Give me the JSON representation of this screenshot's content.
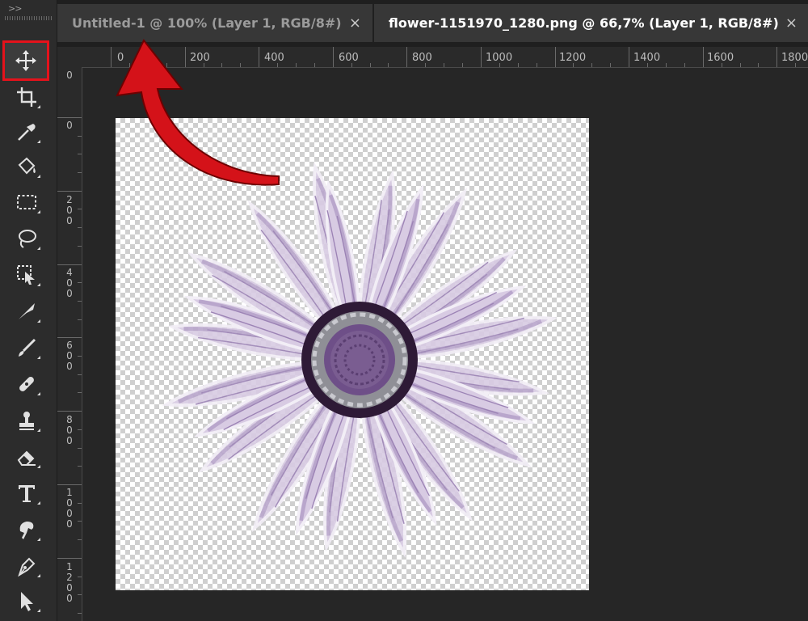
{
  "toolbar": {
    "collapse_glyph": ">>",
    "tools": [
      "move-tool",
      "crop-tool",
      "eyedropper-tool",
      "paint-bucket-tool",
      "rectangular-marquee-tool",
      "lasso-tool",
      "object-selection-tool",
      "pen-curvature-tool",
      "brush-tool",
      "healing-brush-tool",
      "clone-stamp-tool",
      "eraser-tool",
      "type-tool",
      "smudge-tool",
      "pen-tool",
      "path-selection-tool"
    ],
    "selected_tool": "move-tool"
  },
  "tabs": [
    {
      "title": "Untitled-1 @ 100% (Layer 1, RGB/8#)",
      "close": "×",
      "active": false
    },
    {
      "title": "flower-1151970_1280.png @ 66,7% (Layer 1, RGB/8#)",
      "close": "×",
      "active": true
    }
  ],
  "ruler": {
    "horizontal_labels": [
      "0",
      "200",
      "400",
      "600",
      "800",
      "1000",
      "1200",
      "1400",
      "1600",
      "1800"
    ],
    "vertical_labels": [
      "0",
      "0",
      "200",
      "400",
      "600",
      "800",
      "1000",
      "1200"
    ]
  },
  "colors": {
    "highlight": "#e5121b",
    "petal": "#d8cbe3",
    "petal_dark": "#b9a6cc",
    "center": "#7a5d91",
    "disc_dots": "#8f8f96"
  }
}
